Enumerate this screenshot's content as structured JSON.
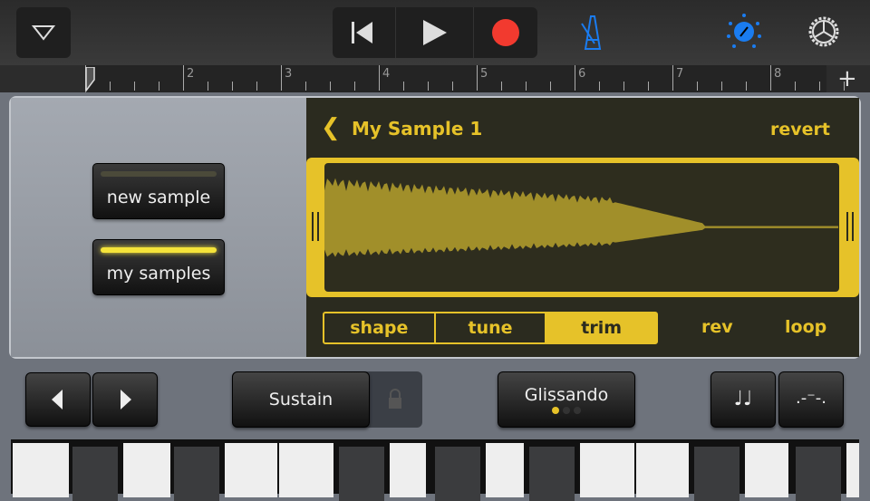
{
  "toolbar": {
    "menu_icon": "triangle-down-icon",
    "rewind_icon": "skip-back-icon",
    "play_icon": "play-icon",
    "record_icon": "record-icon",
    "metronome_icon": "metronome-icon",
    "tone_icon": "knob-icon",
    "settings_icon": "gear-icon",
    "accent": "#1a7cf0",
    "record_color": "#f23a2f"
  },
  "ruler": {
    "measures": [
      "2",
      "3",
      "4",
      "5",
      "6",
      "7",
      "8"
    ],
    "add_label": "+"
  },
  "sampler": {
    "new_sample": "new sample",
    "my_samples": "my samples",
    "selected": "my samples",
    "title": "My Sample 1",
    "revert": "revert",
    "tabs": [
      "shape",
      "tune",
      "trim"
    ],
    "active_tab": "trim",
    "rev": "rev",
    "loop": "loop",
    "accent": "#e6c229"
  },
  "controls": {
    "sustain": "Sustain",
    "glissando": "Glissando",
    "glissando_level": 1,
    "note_icon": "notes-icon",
    "arp_icon": "arpeggiator-icon"
  }
}
